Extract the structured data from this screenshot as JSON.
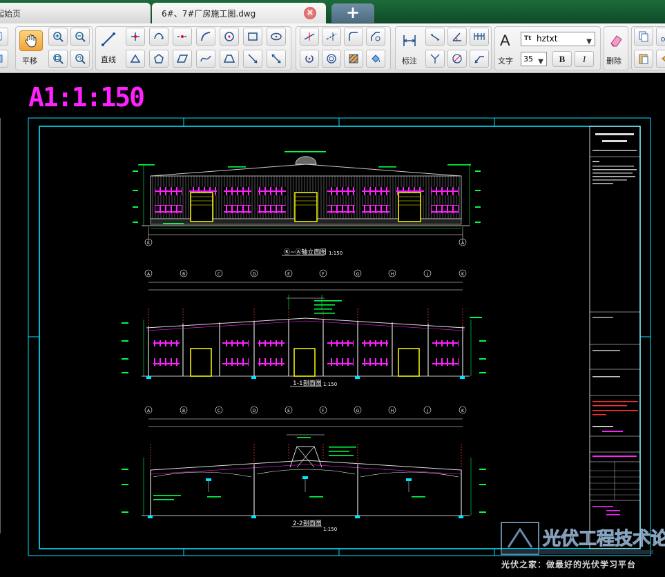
{
  "tabs": [
    {
      "label": "起始页"
    },
    {
      "label": "6#、7#厂房施工图.dwg",
      "close_symbol": "×"
    }
  ],
  "add_tab_symbol": "+",
  "toolbar": {
    "pan_label": "平移",
    "line_label": "直线",
    "dimension_label": "标注",
    "text_label": "文字",
    "text_icon": "A",
    "delete_label": "删除",
    "font_value": "hztxt",
    "font_size_value": "35",
    "bold_label": "B",
    "italic_label": "I"
  },
  "drawing": {
    "scale_label": "A1:1:150",
    "elevation_title": "Ⓚ~Ⓐ轴立面图",
    "elevation_scale": "1:150",
    "section1_title": "1-1剖面图",
    "section1_scale": "1:150",
    "section2_title": "2-2剖面图",
    "section2_scale": "1:150",
    "grid_letters": [
      "A",
      "B",
      "C",
      "D",
      "E",
      "F",
      "G",
      "H",
      "J",
      "K"
    ]
  },
  "watermark": {
    "brand": "光伏工程技术论坛",
    "slogan": "光伏之家：做最好的光伏学习平台"
  },
  "colors": {
    "tab_bar": "#1d6b3a",
    "drawing_bg": "#000000",
    "frame": "#00e5ff",
    "drawing_white": "#ffffff",
    "windows": "#ff22ff",
    "doors": "#ffff00",
    "dims": "#00ff44",
    "axis_red": "#ff3030"
  }
}
